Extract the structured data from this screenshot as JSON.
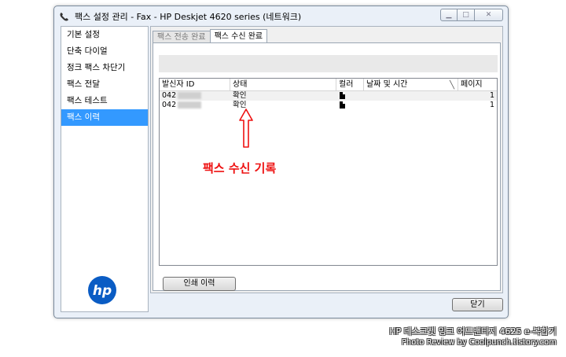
{
  "window": {
    "title": "팩스 설정 관리 - Fax - HP Deskjet 4620 series (네트워크)"
  },
  "sidebar": {
    "items": [
      {
        "label": "기본 설정",
        "active": false
      },
      {
        "label": "단축 다이얼",
        "active": false
      },
      {
        "label": "정크 팩스 차단기",
        "active": false
      },
      {
        "label": "팩스 전달",
        "active": false
      },
      {
        "label": "팩스 테스트",
        "active": false
      },
      {
        "label": "팩스 이력",
        "active": true
      }
    ],
    "logo_text": "hp"
  },
  "tabs": [
    {
      "label": "팩스 전송 완료",
      "active": false
    },
    {
      "label": "팩스 수신 완료",
      "active": true
    }
  ],
  "table": {
    "columns": [
      "발신자 ID",
      "상태",
      "컬러",
      "날짜 및 시간",
      "페이지"
    ],
    "rows": [
      {
        "sender": "042",
        "status": "확인",
        "pages": "1"
      },
      {
        "sender": "042",
        "status": "확인",
        "pages": "1"
      }
    ]
  },
  "buttons": {
    "print_label": "인쇄 이력",
    "close_label": "닫기"
  },
  "annotation": {
    "text": "팩스 수신 기록",
    "color": "#ee1111"
  },
  "watermark": {
    "line1": "HP 데스크젯 잉크 어드밴티지 4625 e-복합기",
    "line2": "Photo Review by Coolpunch.tistory.com"
  }
}
